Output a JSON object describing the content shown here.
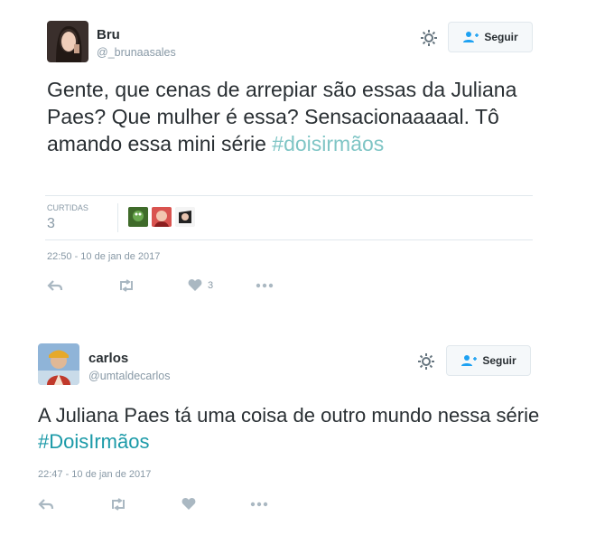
{
  "tweets": [
    {
      "name": "Bru",
      "handle": "@_brunaasales",
      "follow_label": "Seguir",
      "text": "Gente, que cenas de arrepiar são essas da Juliana Paes? Que mulher é essa? Sensacionaaaaal. Tô amando essa mini série ",
      "hashtag": "#doisirmãos",
      "likes_label": "CURTIDAS",
      "likes_count": "3",
      "timestamp": "22:50 - 10 de jan de 2017",
      "like_action_count": "3"
    },
    {
      "name": "carlos",
      "handle": "@umtaldecarlos",
      "follow_label": "Seguir",
      "text": "A Juliana Paes tá uma coisa de outro mundo nessa série ",
      "hashtag": "#DoisIrmãos",
      "timestamp": "22:47 - 10 de jan de 2017"
    }
  ],
  "icons": {
    "settings": "gear-icon",
    "follow": "add-user-icon",
    "reply": "reply-icon",
    "retweet": "retweet-icon",
    "like": "heart-icon",
    "more": "more-icon"
  },
  "colors": {
    "text": "#292f33",
    "muted": "#8899a6",
    "hashtag_1": "#7fc5c5",
    "hashtag_2": "#1b9aa8",
    "border": "#e1e8ed"
  }
}
